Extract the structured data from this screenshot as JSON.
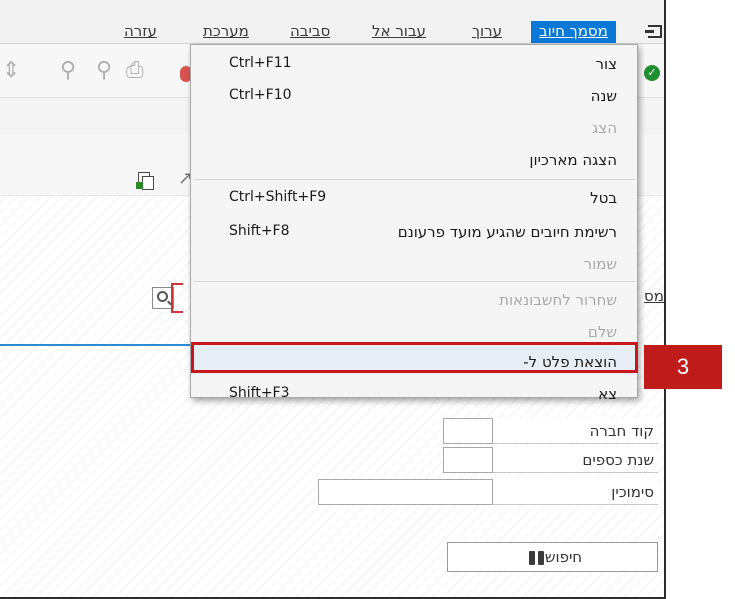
{
  "menubar": {
    "items": [
      {
        "label": "מסמך חיוב",
        "active": true
      },
      {
        "label": "ערוך"
      },
      {
        "label": "עבור אל"
      },
      {
        "label": "סביבה"
      },
      {
        "label": "מערכת"
      },
      {
        "label": "עזרה"
      }
    ]
  },
  "toolbar": {
    "icons": [
      "exit-icon",
      "ok-icon",
      "print-icon",
      "find-icon",
      "find-next-icon",
      "page-icon",
      "scroll-icon"
    ]
  },
  "appbar": {
    "icons": [
      "document-overview-icon",
      "arrow-icon"
    ]
  },
  "dropdown": {
    "items": [
      {
        "label": "צור",
        "shortcut": "Ctrl+F11",
        "enabled": true
      },
      {
        "label": "שנה",
        "shortcut": "Ctrl+F10",
        "enabled": true
      },
      {
        "label": "הצג",
        "shortcut": "",
        "enabled": false
      },
      {
        "label": "הצגה מארכיון",
        "shortcut": "",
        "enabled": true
      },
      {
        "label": "בטל",
        "shortcut": "Ctrl+Shift+F9",
        "enabled": true
      },
      {
        "label": "רשימת חיובים שהגיע מועד פרעונם",
        "shortcut": "Shift+F8",
        "enabled": true
      },
      {
        "label": "שמור",
        "shortcut": "",
        "enabled": false
      },
      {
        "label": "שחרור לחשבונאות",
        "shortcut": "",
        "enabled": false
      },
      {
        "label": "שלם",
        "shortcut": "",
        "enabled": false
      },
      {
        "label": "הוצאת פלט ל-",
        "shortcut": "",
        "enabled": true,
        "highlighted": true
      },
      {
        "label": "צא",
        "shortcut": "Shift+F3",
        "enabled": true
      }
    ]
  },
  "form": {
    "partial_label_1": "מס",
    "company_code_label": "קוד חברה",
    "fiscal_year_label": "שנת כספים",
    "reference_label": "סימוכין",
    "search_button_label": "חיפוש"
  },
  "callout": {
    "number": "3",
    "color": "#c8161d"
  },
  "colors": {
    "active_menu": "#0a78d7",
    "callout_red": "#bf1b1b"
  }
}
